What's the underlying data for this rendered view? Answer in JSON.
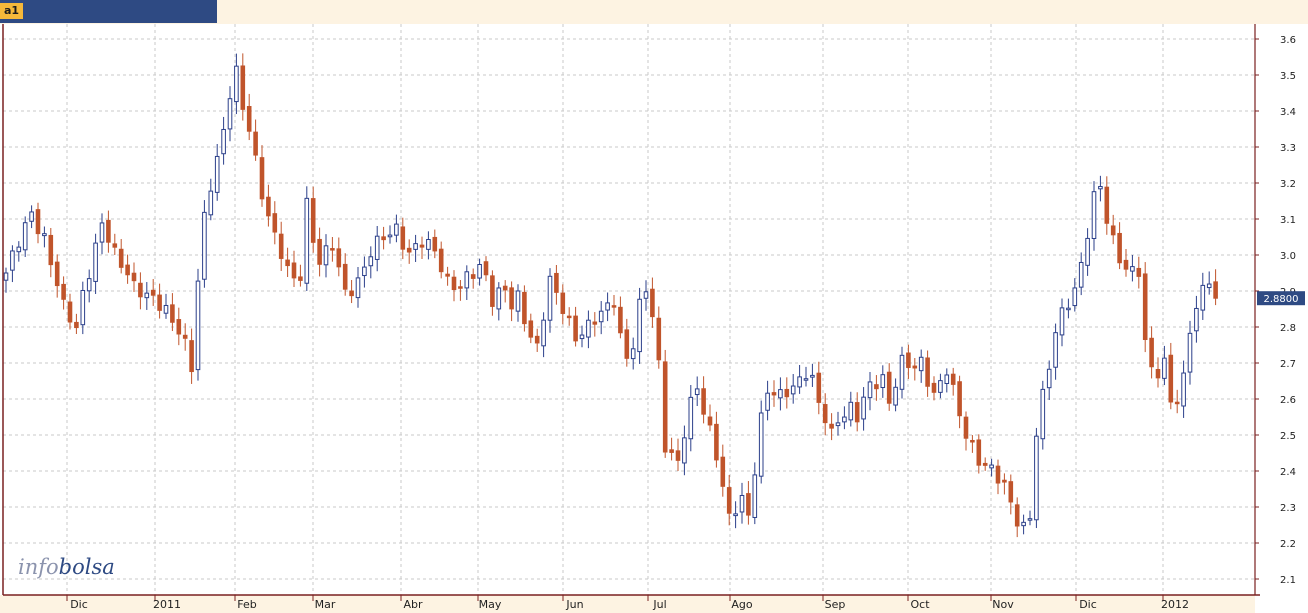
{
  "tab": {
    "label": "a1"
  },
  "watermark": {
    "part1": "info",
    "part2": "bolsa"
  },
  "colors": {
    "up": "#2b3f8a",
    "down": "#c0542b",
    "grid": "#c9c9c9",
    "frame": "#7a2020"
  },
  "chart_data": {
    "type": "candlestick",
    "title": "",
    "xlabel": "",
    "ylabel": "",
    "ylim": [
      2.05,
      3.63
    ],
    "y_ticks": [
      "2.1",
      "2.2",
      "2.3",
      "2.4",
      "2.5",
      "2.6",
      "2.7",
      "2.8",
      "2.9",
      "3.0",
      "3.1",
      "3.2",
      "3.3",
      "3.4",
      "3.5",
      "3.6"
    ],
    "x_labels": [
      "Dic",
      "2011",
      "Feb",
      "Mar",
      "Abr",
      "May",
      "Jun",
      "Jul",
      "Ago",
      "Sep",
      "Oct",
      "Nov",
      "Dic",
      "2012"
    ],
    "last_price_label": "2.8800",
    "last_price": 2.88,
    "grid": true,
    "close_path": [
      [
        0,
        2.95
      ],
      [
        2,
        3.03
      ],
      [
        4,
        3.12
      ],
      [
        6,
        3.05
      ],
      [
        7,
        2.98
      ],
      [
        9,
        2.85
      ],
      [
        11,
        2.8
      ],
      [
        12,
        2.9
      ],
      [
        14,
        3.02
      ],
      [
        15,
        3.08
      ],
      [
        17,
        3.0
      ],
      [
        19,
        2.96
      ],
      [
        20,
        2.92
      ],
      [
        22,
        2.88
      ],
      [
        24,
        2.86
      ],
      [
        25,
        2.85
      ],
      [
        27,
        2.8
      ],
      [
        28,
        2.75
      ],
      [
        29,
        2.68
      ],
      [
        30,
        2.92
      ],
      [
        31,
        3.1
      ],
      [
        32,
        3.2
      ],
      [
        34,
        3.35
      ],
      [
        35,
        3.45
      ],
      [
        36,
        3.5
      ],
      [
        37,
        3.4
      ],
      [
        38,
        3.35
      ],
      [
        40,
        3.18
      ],
      [
        42,
        3.05
      ],
      [
        43,
        3.0
      ],
      [
        44,
        2.95
      ],
      [
        45,
        2.93
      ],
      [
        46,
        2.95
      ],
      [
        47,
        3.15
      ],
      [
        48,
        3.05
      ],
      [
        49,
        2.98
      ],
      [
        51,
        3.02
      ],
      [
        53,
        2.9
      ],
      [
        55,
        2.93
      ],
      [
        57,
        3.0
      ],
      [
        59,
        3.05
      ],
      [
        61,
        3.08
      ],
      [
        63,
        3.0
      ],
      [
        65,
        3.03
      ],
      [
        67,
        3.02
      ],
      [
        69,
        2.93
      ],
      [
        71,
        2.9
      ],
      [
        72,
        2.93
      ],
      [
        74,
        2.97
      ],
      [
        75,
        2.95
      ],
      [
        76,
        2.88
      ],
      [
        78,
        2.9
      ],
      [
        79,
        2.85
      ],
      [
        80,
        2.88
      ],
      [
        82,
        2.78
      ],
      [
        83,
        2.75
      ],
      [
        85,
        2.92
      ],
      [
        87,
        2.85
      ],
      [
        89,
        2.78
      ],
      [
        91,
        2.8
      ],
      [
        93,
        2.83
      ],
      [
        95,
        2.88
      ],
      [
        96,
        2.78
      ],
      [
        97,
        2.72
      ],
      [
        98,
        2.75
      ],
      [
        99,
        2.85
      ],
      [
        100,
        2.9
      ],
      [
        101,
        2.83
      ],
      [
        102,
        2.7
      ],
      [
        103,
        2.48
      ],
      [
        105,
        2.42
      ],
      [
        106,
        2.5
      ],
      [
        107,
        2.58
      ],
      [
        108,
        2.63
      ],
      [
        110,
        2.52
      ],
      [
        111,
        2.45
      ],
      [
        113,
        2.26
      ],
      [
        115,
        2.32
      ],
      [
        116,
        2.28
      ],
      [
        118,
        2.55
      ],
      [
        119,
        2.62
      ],
      [
        121,
        2.6
      ],
      [
        122,
        2.62
      ],
      [
        124,
        2.66
      ],
      [
        125,
        2.68
      ],
      [
        126,
        2.65
      ],
      [
        127,
        2.58
      ],
      [
        129,
        2.5
      ],
      [
        130,
        2.55
      ],
      [
        132,
        2.58
      ],
      [
        133,
        2.55
      ],
      [
        135,
        2.63
      ],
      [
        137,
        2.66
      ],
      [
        138,
        2.6
      ],
      [
        140,
        2.7
      ],
      [
        142,
        2.68
      ],
      [
        143,
        2.7
      ],
      [
        145,
        2.62
      ],
      [
        146,
        2.65
      ],
      [
        147,
        2.68
      ],
      [
        149,
        2.55
      ],
      [
        150,
        2.5
      ],
      [
        152,
        2.44
      ],
      [
        154,
        2.4
      ],
      [
        156,
        2.35
      ],
      [
        158,
        2.27
      ],
      [
        159,
        2.25
      ],
      [
        160,
        2.28
      ],
      [
        161,
        2.5
      ],
      [
        162,
        2.6
      ],
      [
        164,
        2.78
      ],
      [
        165,
        2.85
      ],
      [
        166,
        2.88
      ],
      [
        167,
        2.9
      ],
      [
        169,
        3.05
      ],
      [
        170,
        3.15
      ],
      [
        171,
        3.2
      ],
      [
        172,
        3.1
      ],
      [
        174,
        3.0
      ],
      [
        175,
        2.95
      ],
      [
        177,
        2.95
      ],
      [
        178,
        2.75
      ],
      [
        179,
        2.7
      ],
      [
        180,
        2.68
      ],
      [
        181,
        2.7
      ],
      [
        182,
        2.6
      ],
      [
        183,
        2.58
      ],
      [
        184,
        2.65
      ],
      [
        185,
        2.8
      ],
      [
        186,
        2.85
      ],
      [
        187,
        2.92
      ],
      [
        188,
        2.94
      ],
      [
        189,
        2.88
      ]
    ]
  }
}
